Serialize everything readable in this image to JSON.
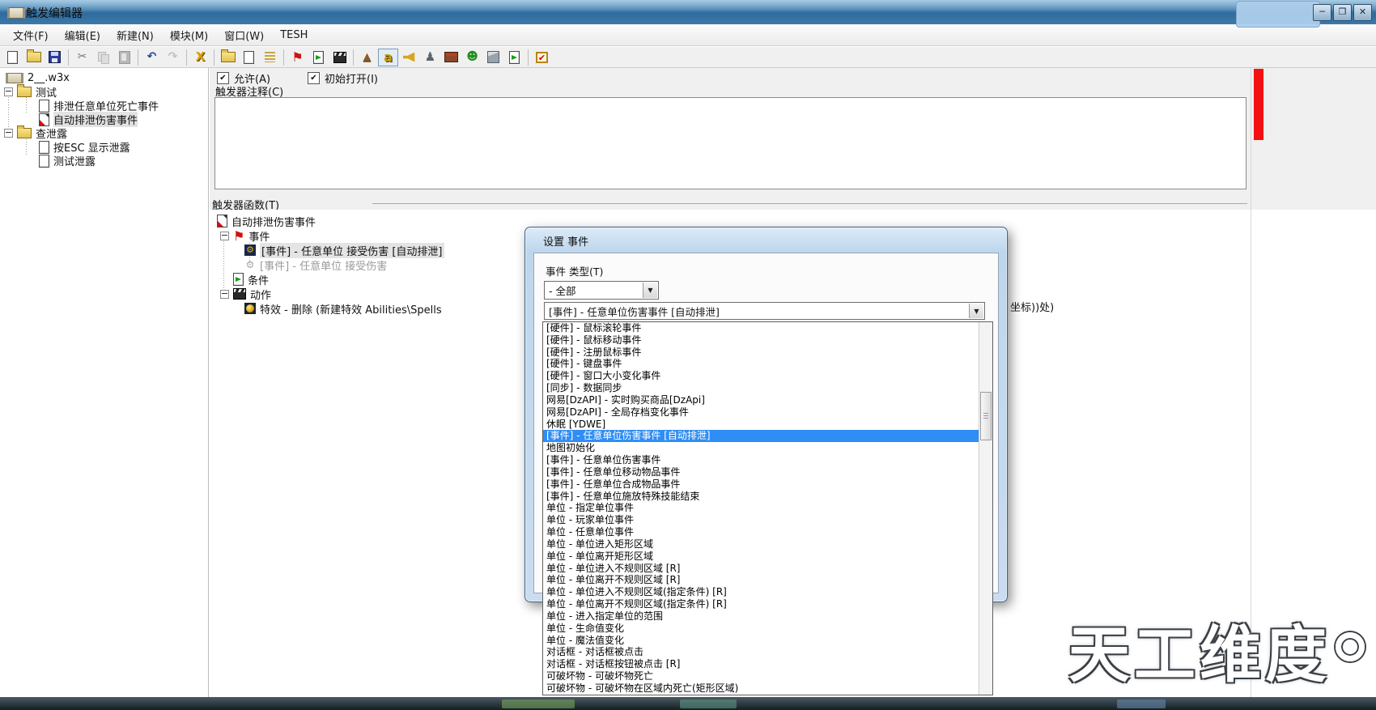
{
  "window": {
    "title": "触发编辑器",
    "controls": {
      "minimize": "─",
      "maximize": "❐",
      "close": "✕"
    }
  },
  "menu": {
    "items": [
      {
        "name": "file",
        "label": "文件(F)"
      },
      {
        "name": "edit",
        "label": "编辑(E)"
      },
      {
        "name": "new",
        "label": "新建(N)"
      },
      {
        "name": "module",
        "label": "模块(M)"
      },
      {
        "name": "window",
        "label": "窗口(W)"
      },
      {
        "name": "tesh",
        "label": "TESH"
      }
    ]
  },
  "toolbar": {
    "buttons": [
      {
        "name": "new-map-button",
        "icon": "new-document-icon",
        "cls": "ic-page",
        "glyph": ""
      },
      {
        "name": "open-map-button",
        "icon": "open-folder-icon",
        "cls": "ic-folder-open",
        "glyph": ""
      },
      {
        "name": "save-map-button",
        "icon": "floppy-disk-icon",
        "cls": "ic-floppy",
        "glyph": ""
      },
      {
        "sep": true
      },
      {
        "name": "cut-button",
        "icon": "scissors-icon",
        "cls": "ic-glyph",
        "glyph": "✂",
        "state": "disabled"
      },
      {
        "name": "copy-button",
        "icon": "copy-pages-icon",
        "cls": "ic-copy",
        "glyph": "",
        "state": "disabled"
      },
      {
        "name": "paste-button",
        "icon": "clipboard-icon",
        "cls": "ic-paste",
        "glyph": "",
        "state": "disabled"
      },
      {
        "sep": true
      },
      {
        "name": "undo-button",
        "icon": "undo-arrow-icon",
        "cls": "ic-glyph undo",
        "glyph": "↶"
      },
      {
        "name": "redo-button",
        "icon": "redo-arrow-icon",
        "cls": "ic-glyph redo",
        "glyph": "↷",
        "state": "disabled"
      },
      {
        "sep": true
      },
      {
        "name": "delete-button",
        "icon": "gold-x-icon",
        "cls": "ic-glyph xdel",
        "glyph": "X"
      },
      {
        "sep": true
      },
      {
        "name": "new-category-button",
        "icon": "folder-icon",
        "cls": "ic-folder",
        "glyph": ""
      },
      {
        "name": "new-trigger-button",
        "icon": "document-icon",
        "cls": "ic-page",
        "glyph": ""
      },
      {
        "name": "new-comment-button",
        "icon": "text-lines-icon",
        "cls": "ic-lines",
        "glyph": ""
      },
      {
        "sep": true
      },
      {
        "name": "new-event-button",
        "icon": "red-flag-icon",
        "cls": "ic-glyph flag",
        "glyph": "⚑"
      },
      {
        "name": "new-condition-button",
        "icon": "page-green-arrow-icon",
        "cls": "ic-page green-arrow",
        "glyph": ""
      },
      {
        "name": "new-action-button",
        "icon": "clapperboard-icon",
        "cls": "ic-clapper",
        "glyph": ""
      },
      {
        "sep": true
      },
      {
        "name": "terrain-editor-button",
        "icon": "mountain-icon",
        "cls": "ic-glyph mountain",
        "glyph": "▲"
      },
      {
        "name": "trigger-editor-button",
        "icon": "letter-a-icon",
        "cls": "ic-glyph abtn",
        "glyph": "a",
        "state": "pressed"
      },
      {
        "name": "sound-editor-button",
        "icon": "speaker-icon",
        "cls": "ic-speaker",
        "glyph": ""
      },
      {
        "name": "object-editor-button",
        "icon": "unit-figure-icon",
        "cls": "ic-glyph unit",
        "glyph": "♟"
      },
      {
        "name": "campaign-editor-button",
        "icon": "cart-icon",
        "cls": "ic-cart",
        "glyph": ""
      },
      {
        "name": "ai-editor-button",
        "icon": "green-face-icon",
        "cls": "ic-glyph aiface",
        "glyph": "☻"
      },
      {
        "name": "object-manager-button",
        "icon": "cube-icon",
        "cls": "ic-cube",
        "glyph": ""
      },
      {
        "name": "import-manager-button",
        "icon": "page-green-arrow-icon",
        "cls": "ic-page green-arrow",
        "glyph": ""
      },
      {
        "sep": true
      },
      {
        "name": "test-map-button",
        "icon": "red-check-icon",
        "cls": "ic-test",
        "glyph": "✔"
      }
    ]
  },
  "sidebar_tree": {
    "rows": [
      {
        "label": "2__.w3x"
      },
      {
        "label": "测试"
      },
      {
        "label": "排泄任意单位死亡事件"
      },
      {
        "label": "自动排泄伤害事件",
        "selected": true
      },
      {
        "label": "查泄露"
      },
      {
        "label": "按ESC 显示泄露"
      },
      {
        "label": "测试泄露"
      }
    ]
  },
  "trigger_panel": {
    "enabled_label": "允许(A)",
    "enabled_checked": "✔",
    "initially_on_label": "初始打开(I)",
    "initially_on_checked": "✔",
    "comment_label": "触发器注释(C)",
    "comment_value": "",
    "functions_label": "触发器函数(T)"
  },
  "function_tree": {
    "rows": [
      {
        "label": "自动排泄伤害事件"
      },
      {
        "label": "事件"
      },
      {
        "label": "[事件] - 任意单位 接受伤害 [自动排泄]",
        "selected": true
      },
      {
        "label": "[事件] - 任意单位 接受伤害",
        "disabled": true
      },
      {
        "label": "条件"
      },
      {
        "label": "动作"
      },
      {
        "label_left": "特效 - 删除 (新建特效 Abilities\\Spells",
        "label_right": "坐标))处)"
      }
    ]
  },
  "dialog": {
    "title": "设置 事件",
    "event_type_label": "事件 类型(T)",
    "event_type_value": "- 全部",
    "selected_event": "[事件] - 任意单位伤害事件 [自动排泄]",
    "selected_index": 9,
    "dropdown_arrow": "▼",
    "events": [
      "[硬件] - 鼠标滚轮事件",
      "[硬件] - 鼠标移动事件",
      "[硬件] - 注册鼠标事件",
      "[硬件] - 键盘事件",
      "[硬件] - 窗口大小变化事件",
      "[同步] - 数据同步",
      "网易[DzAPI] - 实时购买商品[DzApi]",
      "网易[DzAPI] - 全局存档变化事件",
      "休眠 [YDWE]",
      "[事件] - 任意单位伤害事件 [自动排泄]",
      "地图初始化",
      "[事件] - 任意单位伤害事件",
      "[事件] - 任意单位移动物品事件",
      "[事件] - 任意单位合成物品事件",
      "[事件] - 任意单位施放特殊技能结束",
      "单位 - 指定单位事件",
      "单位 - 玩家单位事件",
      "单位 - 任意单位事件",
      "单位 - 单位进入矩形区域",
      "单位 - 单位离开矩形区域",
      "单位 - 单位进入不规则区域 [R]",
      "单位 - 单位离开不规则区域 [R]",
      "单位 - 单位进入不规则区域(指定条件) [R]",
      "单位 - 单位离开不规则区域(指定条件) [R]",
      "单位 - 进入指定单位的范围",
      "单位 - 生命值变化",
      "单位 - 魔法值变化",
      "对话框 - 对话框被点击",
      "对话框 - 对话框按钮被点击 [R]",
      "可破坏物 - 可破坏物死亡",
      "可破坏物 - 可破坏物在区域内死亡(矩形区域)"
    ]
  },
  "watermark": {
    "text": "天工维度"
  },
  "colors": {
    "titlebar_blue": "#3c79a9",
    "selection_blue": "#2f8ef5",
    "inactive_selection_gray": "#e2e2e2",
    "red_flag": "#cf1212",
    "gold_accent": "#d8a510"
  }
}
